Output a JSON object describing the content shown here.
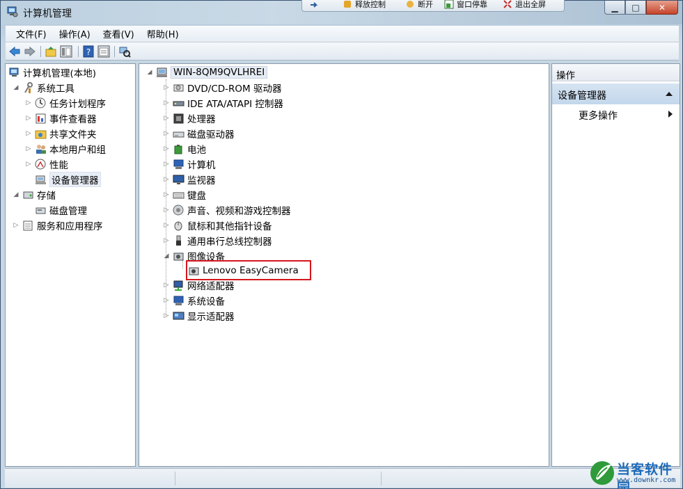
{
  "window": {
    "title": "计算机管理"
  },
  "remote_bar": {
    "items": [
      {
        "label": "释放控制",
        "icon": "release-control-icon"
      },
      {
        "label": "断开",
        "icon": "disconnect-icon"
      },
      {
        "label": "窗口停靠",
        "icon": "window-dock-icon"
      },
      {
        "label": "退出全屏",
        "icon": "exit-fullscreen-icon"
      }
    ]
  },
  "window_controls": {
    "minimize": "▁",
    "maximize": "□",
    "close": "✕"
  },
  "menu": {
    "items": [
      {
        "label": "文件(F)"
      },
      {
        "label": "操作(A)"
      },
      {
        "label": "查看(V)"
      },
      {
        "label": "帮助(H)"
      }
    ]
  },
  "toolbar": {
    "buttons": [
      "back-icon",
      "forward-icon",
      "up-folder-icon",
      "show-hide-tree-icon",
      "help-icon",
      "properties-icon",
      "scan-hardware-icon"
    ]
  },
  "left_tree": {
    "root": "计算机管理(本地)",
    "system_tools": "系统工具",
    "items": [
      {
        "label": "任务计划程序",
        "icon": "clock-icon"
      },
      {
        "label": "事件查看器",
        "icon": "event-viewer-icon"
      },
      {
        "label": "共享文件夹",
        "icon": "shared-folder-icon"
      },
      {
        "label": "本地用户和组",
        "icon": "users-icon"
      },
      {
        "label": "性能",
        "icon": "performance-icon"
      },
      {
        "label": "设备管理器",
        "icon": "device-manager-icon"
      }
    ],
    "storage": "存储",
    "disk_management": "磁盘管理",
    "services": "服务和应用程序"
  },
  "device_tree": {
    "computer_name": "WIN-8QM9QVLHREI",
    "categories": [
      {
        "label": "DVD/CD-ROM 驱动器",
        "icon": "dvd-drive-icon"
      },
      {
        "label": "IDE ATA/ATAPI 控制器",
        "icon": "ide-controller-icon"
      },
      {
        "label": "处理器",
        "icon": "processor-icon"
      },
      {
        "label": "磁盘驱动器",
        "icon": "disk-drive-icon"
      },
      {
        "label": "电池",
        "icon": "battery-icon"
      },
      {
        "label": "计算机",
        "icon": "computer-icon"
      },
      {
        "label": "监视器",
        "icon": "monitor-icon"
      },
      {
        "label": "键盘",
        "icon": "keyboard-icon"
      },
      {
        "label": "声音、视频和游戏控制器",
        "icon": "sound-icon"
      },
      {
        "label": "鼠标和其他指针设备",
        "icon": "mouse-icon"
      },
      {
        "label": "通用串行总线控制器",
        "icon": "usb-icon"
      },
      {
        "label": "图像设备",
        "icon": "imaging-device-icon"
      }
    ],
    "camera": "Lenovo EasyCamera",
    "after_categories": [
      {
        "label": "网络适配器",
        "icon": "network-adapter-icon"
      },
      {
        "label": "系统设备",
        "icon": "system-device-icon"
      },
      {
        "label": "显示适配器",
        "icon": "display-adapter-icon"
      }
    ]
  },
  "actions_pane": {
    "header": "操作",
    "section": "设备管理器",
    "more": "更多操作"
  },
  "watermark": {
    "text": "当客软件园",
    "url": "www.downkr.com"
  },
  "colors": {
    "highlight_border": "#d4161c",
    "action_section": "#c9dbee"
  }
}
